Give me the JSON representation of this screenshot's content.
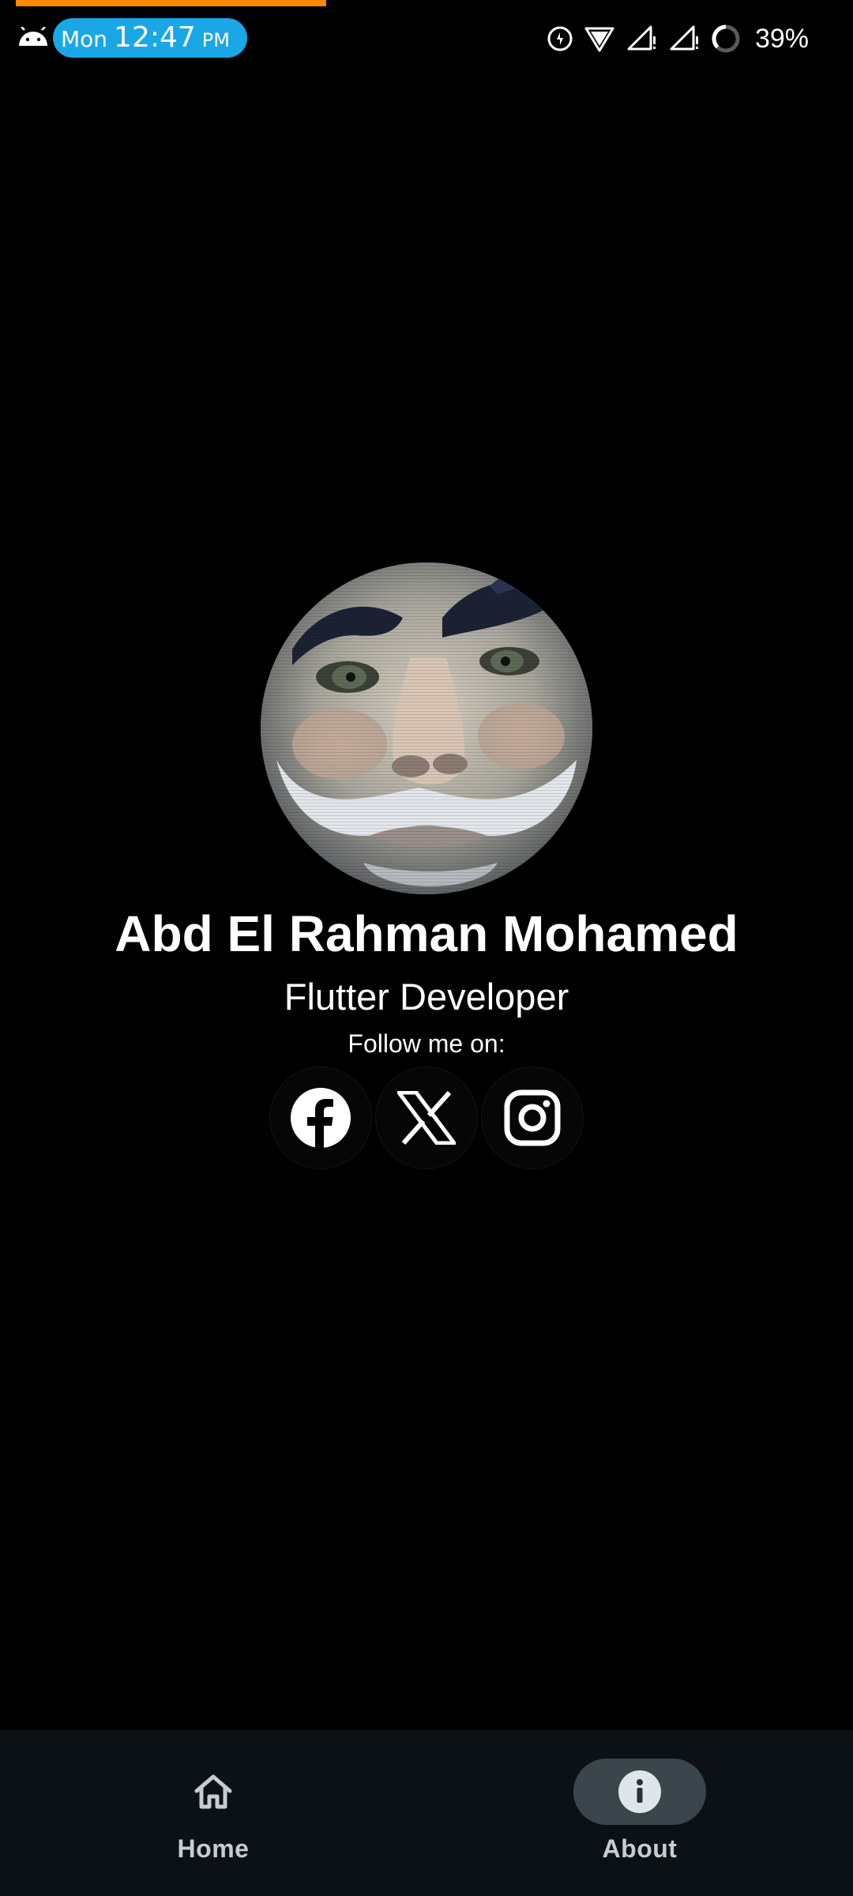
{
  "status_bar": {
    "day": "Mon",
    "time": "12:47",
    "ampm": "PM",
    "battery_text": "39%",
    "pill_color": "#1aa7e6",
    "icons": [
      "android-icon",
      "data-saver-icon",
      "wifi-icon",
      "signal-1-icon",
      "signal-2-icon",
      "battery-ring-icon"
    ]
  },
  "profile": {
    "avatar": "avatar-photo",
    "name": "Abd El Rahman Mohamed",
    "role": "Flutter Developer",
    "follow_text": "Follow me on:"
  },
  "social_links": [
    {
      "icon": "facebook-icon"
    },
    {
      "icon": "x-icon"
    },
    {
      "icon": "instagram-icon"
    }
  ],
  "bottom_nav": {
    "items": [
      {
        "label": "Home",
        "icon": "home-icon",
        "selected": false
      },
      {
        "label": "About",
        "icon": "info-icon",
        "selected": true
      }
    ]
  },
  "colors": {
    "background": "#000000",
    "nav_background": "#0b1114",
    "nav_selected_pill": "#3a454c",
    "progress_accent": "#ff8a00"
  }
}
